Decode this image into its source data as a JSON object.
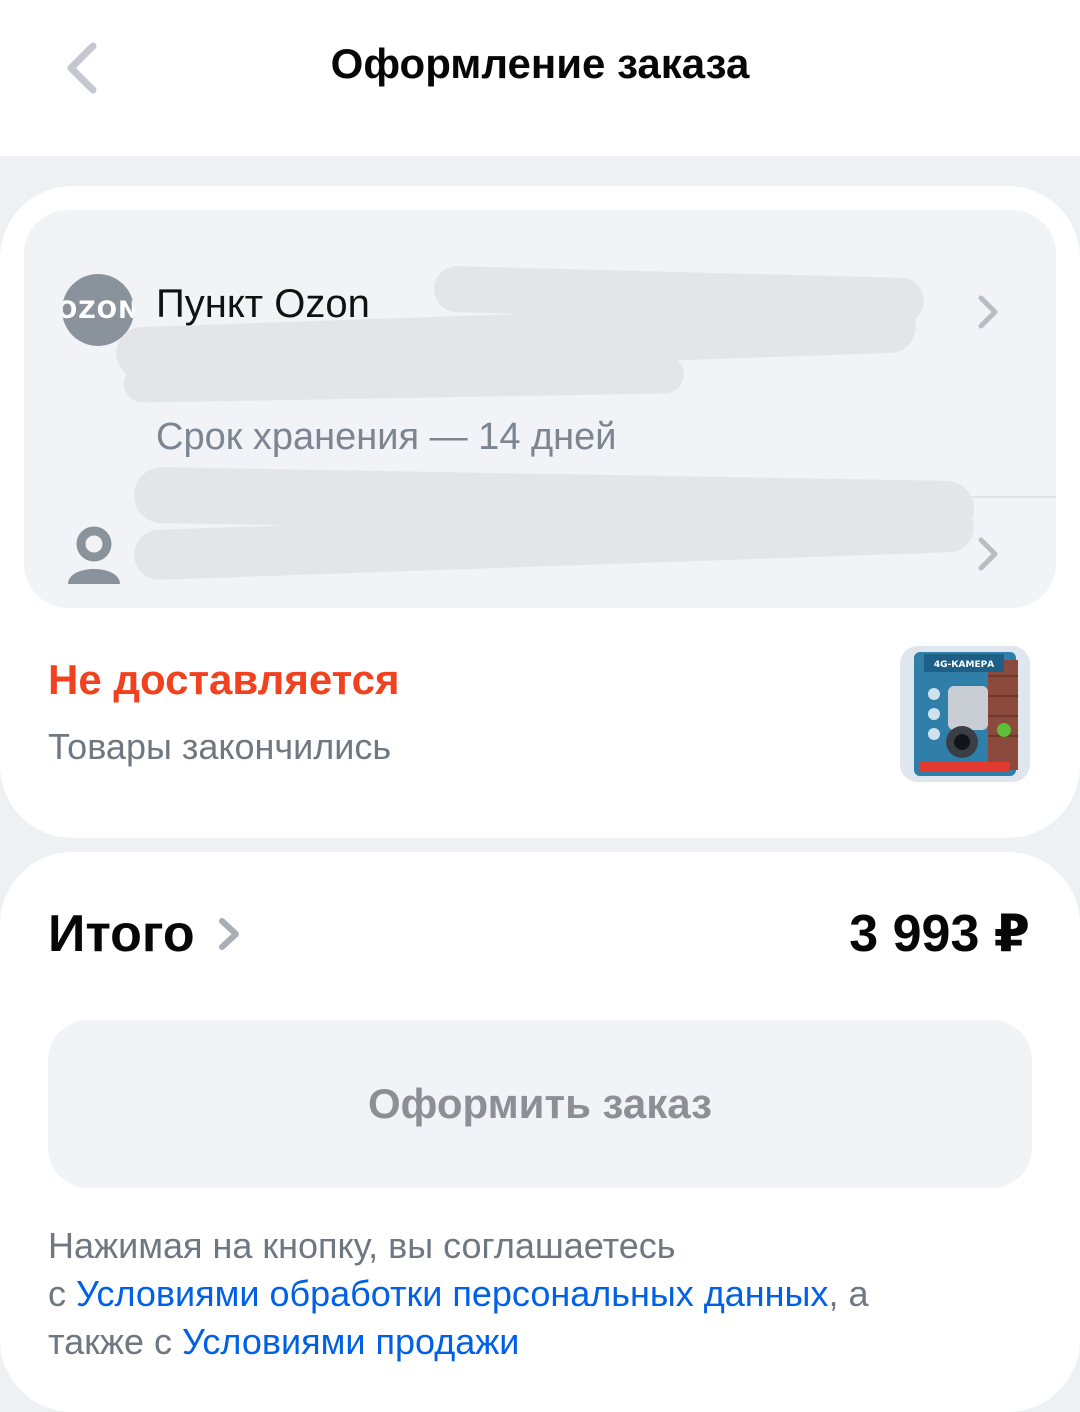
{
  "header": {
    "title": "Оформление заказа"
  },
  "delivery": {
    "pickup_title": "Пункт Ozon",
    "storage": "Срок хранения — 14 дней",
    "logo_text": "OZON"
  },
  "status": {
    "title": "Не доставляется",
    "subtitle": "Товары закончились",
    "product_badge": "4G-КАМЕРА"
  },
  "summary": {
    "total_label": "Итого",
    "total_value": "3 993 ₽",
    "order_button": "Оформить заказ"
  },
  "legal": {
    "line1": "Нажимая на кнопку, вы соглашаетесь",
    "prefix2": "с ",
    "link1": "Условиями обработки персональных данных",
    "middle": ", а",
    "prefix3": "также с ",
    "link2": "Условиями продажи"
  },
  "colors": {
    "accent_red": "#f1411f",
    "link_blue": "#0060e6",
    "background": "#eef0f4"
  }
}
